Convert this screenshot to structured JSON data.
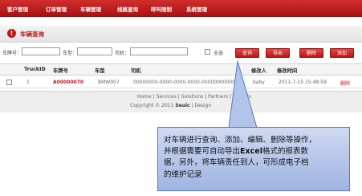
{
  "nav": {
    "items": [
      {
        "label": "客户管理"
      },
      {
        "label": "订单管理"
      },
      {
        "label": "车辆管理"
      },
      {
        "label": "线路查询"
      },
      {
        "label": "呼叫限制"
      },
      {
        "label": "系统管理"
      }
    ]
  },
  "page": {
    "icon_glyph": "!",
    "title": "车辆查询"
  },
  "filters": {
    "plate_label": "车牌号：",
    "model_label": "车型：",
    "driver_label": "司机：",
    "plate_value": "",
    "model_value": "",
    "driver_value": "",
    "select_all_label": "全选"
  },
  "buttons": {
    "query": "查询",
    "export": "导出",
    "delete": "删除",
    "add": "添加"
  },
  "table": {
    "headers": [
      "TruckID",
      "车牌号",
      "车型",
      "司机",
      "修改人",
      "修改时间"
    ],
    "rows": [
      {
        "truck_id": "1",
        "plate": "A00000070",
        "model": "BMW007",
        "driver": "00000000-0000-0000-0000-000000000000",
        "modifier": "baby",
        "modified_time": "2011-7-15 15:48:59",
        "action": "删除"
      }
    ]
  },
  "footer": {
    "link_home": "Home",
    "link_services": "Services",
    "link_solutions": "Solutions",
    "link_partners": "Partners",
    "link_ne": "Ne",
    "link_us": "t Us",
    "copyright_prefix": "Copyright © 2011",
    "brand": "Seuic",
    "suffix": "Design"
  },
  "callout": {
    "line1": "对车辆进行查询、添加、编辑、删除等操作，",
    "line2_a": "并根据需要可自动导出",
    "line2_b": "Excel",
    "line2_c": "格式的报表数",
    "line3": "据，另外，将车辆责任到人，可形成电子档",
    "line4": "的维护记录"
  }
}
